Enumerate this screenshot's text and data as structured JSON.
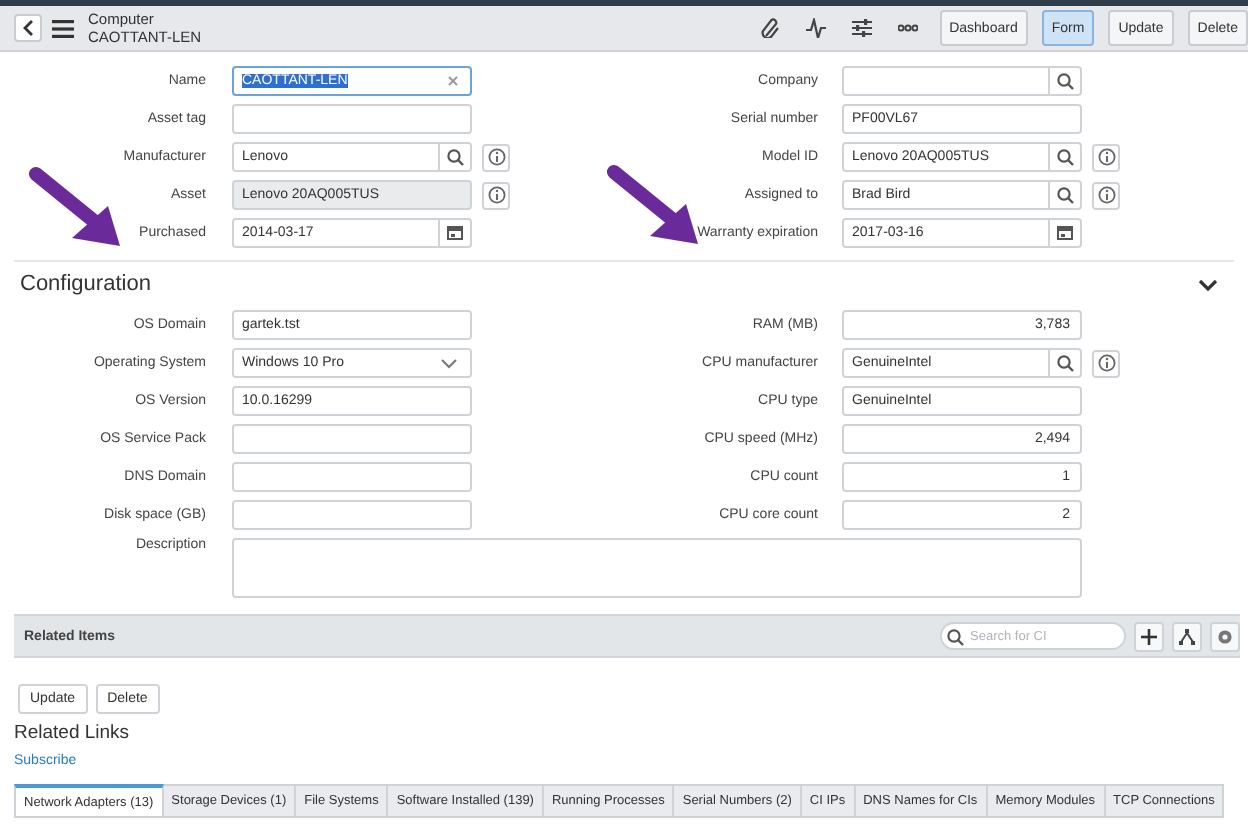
{
  "header": {
    "type": "Computer",
    "record": "CAOTTANT-LEN",
    "views": [
      {
        "label": "Dashboard",
        "selected": false
      },
      {
        "label": "Form",
        "selected": true
      }
    ],
    "buttons": [
      "Update",
      "Delete"
    ]
  },
  "fields": [
    {
      "label": "Name",
      "value": "CAOTTANT-LEN",
      "kind": "clearable",
      "highlighted": true,
      "info": false
    },
    {
      "label": "Company",
      "kind": "reference",
      "highlighted": false,
      "info": false
    },
    {
      "label": "Asset tag",
      "kind": "text",
      "highlighted": false,
      "info": false
    },
    {
      "label": "Serial number",
      "value": "PF00VL67",
      "kind": "text",
      "highlighted": false,
      "info": false
    },
    {
      "label": "Manufacturer",
      "value": "Lenovo",
      "kind": "reference",
      "highlighted": false,
      "info": true
    },
    {
      "label": "Model ID",
      "value": "Lenovo 20AQ005TUS",
      "kind": "reference",
      "highlighted": false,
      "info": true
    },
    {
      "label": "Asset",
      "value": "Lenovo 20AQ005TUS",
      "kind": "readonly",
      "highlighted": false,
      "info": true
    },
    {
      "label": "Assigned to",
      "value": "Brad Bird",
      "kind": "reference",
      "highlighted": false,
      "info": true
    },
    {
      "label": "Purchased",
      "value": "2014-03-17",
      "kind": "date",
      "highlighted": false,
      "info": false
    },
    {
      "label": "Warranty expiration",
      "value": "2017-03-16",
      "kind": "date",
      "highlighted": false,
      "info": false
    }
  ],
  "section": {
    "title": "Configuration",
    "expanded": true,
    "fields": [
      {
        "label": "OS Domain",
        "value": "gartek.tst",
        "kind": "text",
        "info": false
      },
      {
        "label": "RAM (MB)",
        "value": "3,783",
        "kind": "number",
        "info": false
      },
      {
        "label": "Operating System",
        "value": "Windows 10 Pro",
        "kind": "choice",
        "info": false
      },
      {
        "label": "CPU manufacturer",
        "value": "GenuineIntel",
        "kind": "reference",
        "info": true
      },
      {
        "label": "OS Version",
        "value": "10.0.16299",
        "kind": "text",
        "info": false
      },
      {
        "label": "CPU type",
        "value": "GenuineIntel",
        "kind": "text",
        "info": false
      },
      {
        "label": "OS Service Pack",
        "kind": "text",
        "info": false
      },
      {
        "label": "CPU speed (MHz)",
        "value": "2,494",
        "kind": "number",
        "info": false
      },
      {
        "label": "DNS Domain",
        "kind": "text",
        "info": false
      },
      {
        "label": "CPU count",
        "value": "1",
        "kind": "number",
        "info": false
      },
      {
        "label": "Disk space (GB)",
        "kind": "text",
        "info": false
      },
      {
        "label": "CPU core count",
        "value": "2",
        "kind": "number",
        "info": false
      }
    ],
    "description": {
      "label": "Description"
    }
  },
  "related_items": {
    "title": "Related Items",
    "search": {
      "placeholder": "Search for CI"
    }
  },
  "buttons": [
    "Update",
    "Delete"
  ],
  "related_links": {
    "title": "Related Links",
    "links": [
      "Subscribe"
    ]
  },
  "tabs": [
    {
      "label": "Network Adapters (13)",
      "selected": true
    },
    {
      "label": "Storage Devices (1)",
      "selected": false
    },
    {
      "label": "File Systems",
      "selected": false
    },
    {
      "label": "Software Installed (139)",
      "selected": false
    },
    {
      "label": "Running Processes",
      "selected": false
    },
    {
      "label": "Serial Numbers (2)",
      "selected": false
    },
    {
      "label": "CI IPs",
      "selected": false
    },
    {
      "label": "DNS Names for CIs",
      "selected": false
    },
    {
      "label": "Memory Modules",
      "selected": false
    },
    {
      "label": "TCP Connections",
      "selected": false
    }
  ]
}
